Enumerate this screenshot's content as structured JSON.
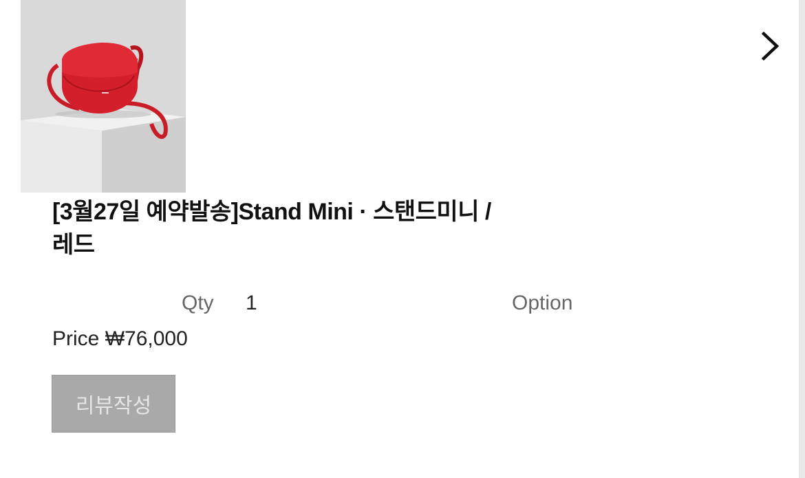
{
  "product": {
    "title_line1": "[3월27일 예약발송]Stand Mini · 스탠드미니 /",
    "title_line2": "레드",
    "image_alt": "Stand Mini red bag"
  },
  "order": {
    "qty_label": "Qty",
    "qty_value": "1",
    "option_label": "Option",
    "price_label": "Price",
    "price_value": "₩76,000"
  },
  "actions": {
    "review_button": "리뷰작성"
  },
  "icons": {
    "next": "chevron-right-icon"
  },
  "colors": {
    "bag": "#d21f2b",
    "button_bg": "#a9a9a9",
    "button_text": "#e6e6e6"
  }
}
